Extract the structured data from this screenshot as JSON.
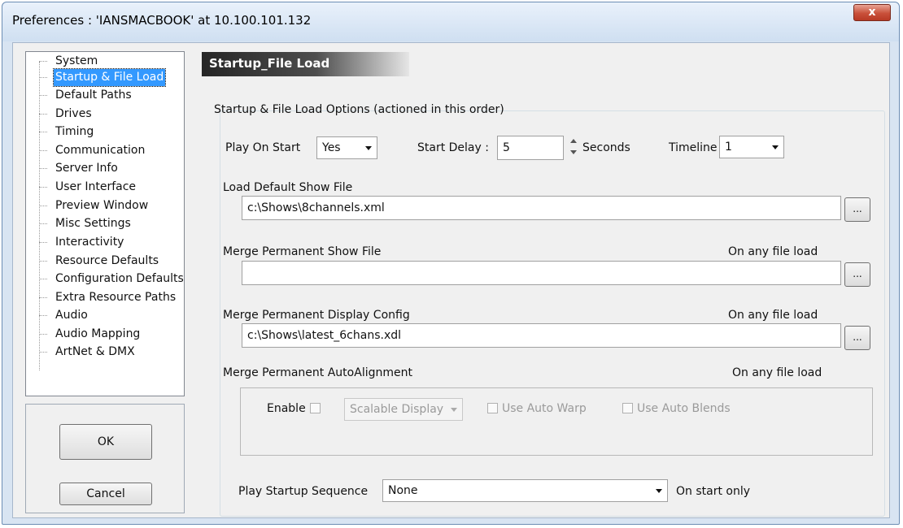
{
  "window": {
    "title": "Preferences  :  'IANSMACBOOK' at 10.100.101.132",
    "close_label": "x"
  },
  "tree": {
    "items": [
      {
        "label": "System",
        "selected": false
      },
      {
        "label": "Startup & File Load",
        "selected": true
      },
      {
        "label": "Default Paths",
        "selected": false
      },
      {
        "label": "Drives",
        "selected": false
      },
      {
        "label": "Timing",
        "selected": false
      },
      {
        "label": "Communication",
        "selected": false
      },
      {
        "label": "Server Info",
        "selected": false
      },
      {
        "label": "User Interface",
        "selected": false
      },
      {
        "label": "Preview Window",
        "selected": false
      },
      {
        "label": "Misc Settings",
        "selected": false
      },
      {
        "label": "Interactivity",
        "selected": false
      },
      {
        "label": "Resource Defaults",
        "selected": false
      },
      {
        "label": "Configuration Defaults",
        "selected": false
      },
      {
        "label": "Extra Resource Paths",
        "selected": false
      },
      {
        "label": "Audio",
        "selected": false
      },
      {
        "label": "Audio Mapping",
        "selected": false
      },
      {
        "label": "ArtNet & DMX",
        "selected": false
      }
    ]
  },
  "buttons": {
    "ok": "OK",
    "cancel": "Cancel"
  },
  "section": {
    "header": "Startup_File Load",
    "group_title": "Startup & File Load Options (actioned in this order)"
  },
  "play_on_start": {
    "label": "Play On Start",
    "value": "Yes"
  },
  "start_delay": {
    "label": "Start Delay :",
    "value": "5",
    "unit": "Seconds"
  },
  "timeline": {
    "label": "Timeline",
    "value": "1"
  },
  "default_show": {
    "label": "Load Default Show File",
    "value": "c:\\Shows\\8channels.xml",
    "browse": "..."
  },
  "merge_show": {
    "label": "Merge Permanent Show File",
    "note": "On any file load",
    "value": "",
    "browse": "..."
  },
  "merge_display": {
    "label": "Merge Permanent Display Config",
    "note": "On any file load",
    "value": "c:\\Shows\\latest_6chans.xdl",
    "browse": "..."
  },
  "auto_alignment": {
    "label": "Merge Permanent AutoAlignment",
    "note": "On any file load",
    "enable_label": "Enable",
    "enable_checked": false,
    "mode_value": "Scalable Display",
    "warp_label": "Use Auto Warp",
    "warp_checked": false,
    "blends_label": "Use Auto Blends",
    "blends_checked": false
  },
  "startup_sequence": {
    "label": "Play Startup Sequence",
    "value": "None",
    "note": "On start only"
  }
}
